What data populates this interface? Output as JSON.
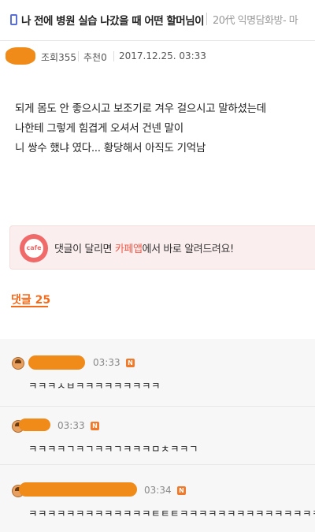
{
  "header": {
    "title": "나 전에 병원 실습 나갔을 때 어떤 할머님이",
    "board": "20代 익명담화방- 마"
  },
  "post": {
    "views": "조회355",
    "recommends": "추천0",
    "date": "2017.12.25. 03:33",
    "lines": [
      "되게 몸도 안 좋으시고 보조기로 겨우 걸으시고 말하셨는데",
      "나한테 그렇게 힘겹게 오셔서 건넨 말이",
      "니 쌍수 했냐 였다... 황당해서 아직도 기억남"
    ]
  },
  "cafe_banner": {
    "logo_text": "cafe",
    "text_before": "댓글이 달리면 ",
    "text_app": "카페앱",
    "text_after": "에서 바로 알려드려요!"
  },
  "comments": {
    "count_label": "댓글 25",
    "items": [
      {
        "time": "03:33",
        "badge": "N",
        "text": "ㅋㅋㅋㅅㅂㅋㅋㅋㅋㅋㅋㅋㅋㅋ"
      },
      {
        "time": "03:33",
        "badge": "N",
        "text": "ㅋㅋㅋㅋㄱㅋㄱㅋㅋㄱㅋㅋㅋㅁㅊㅋㅋㄱ"
      },
      {
        "time": "03:34",
        "badge": "N",
        "text": "ㅋㅋㅋㅋㅋㅋㅋㅋㅋㅋㅋㅋㅋㅌㅌㅌㅋㅋㅋㅋㅋㅋㅋㅋㅋㅋㅋㅋㅋㅋㅋ"
      }
    ]
  },
  "colors": {
    "accent": "#f26a1a",
    "redaction": "#f08a18",
    "cafe": "#f06a6a"
  }
}
